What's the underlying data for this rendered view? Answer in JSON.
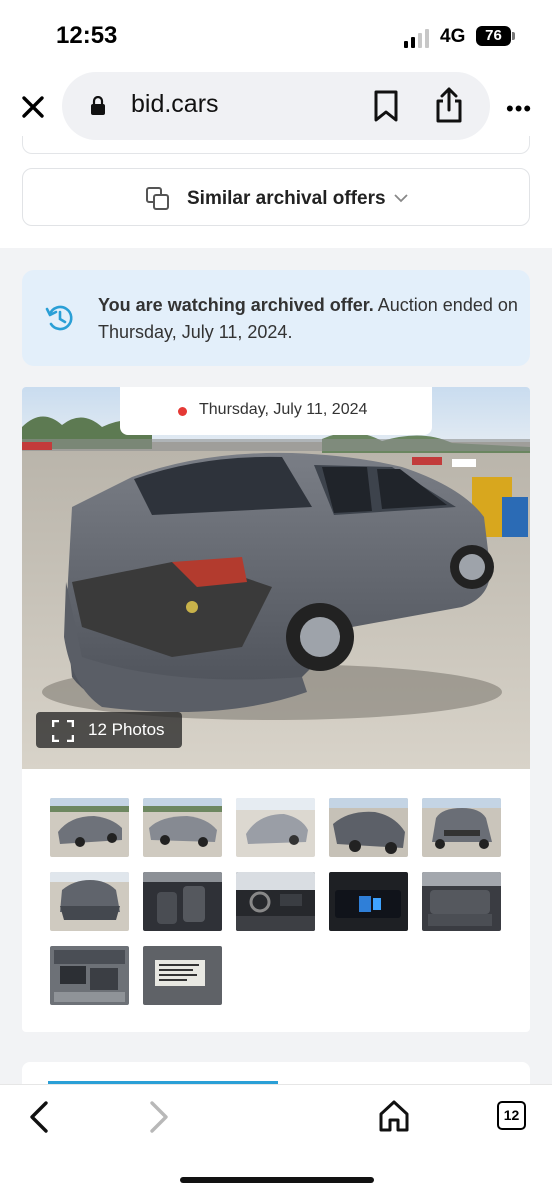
{
  "status_bar": {
    "time": "12:53",
    "network": "4G",
    "battery": "76"
  },
  "browser": {
    "url": "bid.cars",
    "tab_count": "12"
  },
  "similar": {
    "label": "Similar archival offers"
  },
  "notice": {
    "bold_text": "You are watching archived offer.",
    "text": " Auction ended on Thursday, July 11, 2024."
  },
  "gallery": {
    "date": "Thursday, July 11, 2024",
    "photos_label": "12 Photos",
    "thumbnails": [
      "rear-left-view",
      "front-left-view",
      "rear-view-white",
      "front-left-close",
      "front-view",
      "rear-bumper-view",
      "front-seats",
      "dashboard",
      "infotainment-screen",
      "rear-seats",
      "engine-bay",
      "vin-label"
    ]
  },
  "colors": {
    "accent": "#2a9fd6",
    "notice_bg": "#e3effa",
    "dot": "#e53935"
  }
}
